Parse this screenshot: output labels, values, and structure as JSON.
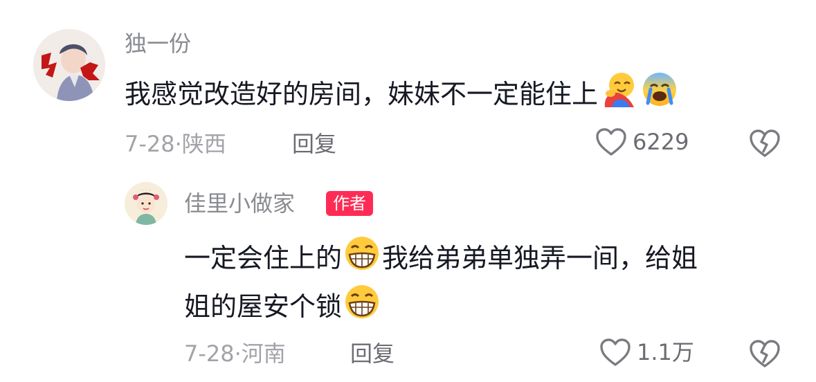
{
  "comment": {
    "username": "独一份",
    "text_main": "我感觉改造好的房间，妹妹不一定能住上",
    "emojis": [
      "hug-emoji",
      "crying-emoji"
    ],
    "date": "7-28",
    "dot": "·",
    "location": "陕西",
    "reply_label": "回复",
    "like_count": "6229"
  },
  "reply": {
    "username": "佳里小做家",
    "author_badge": "作者",
    "text_part1": "一定会住上的",
    "text_part2": "我给弟弟单独弄一间，给姐",
    "text_part3": "姐的屋安个锁",
    "emojis": [
      "grin-emoji",
      "grin-emoji"
    ],
    "date": "7-28",
    "dot": "·",
    "location": "河南",
    "reply_label": "回复",
    "like_count": "1.1万"
  },
  "colors": {
    "accent": "#fe2c55",
    "text": "#161823",
    "secondary": "#8a8b91"
  }
}
